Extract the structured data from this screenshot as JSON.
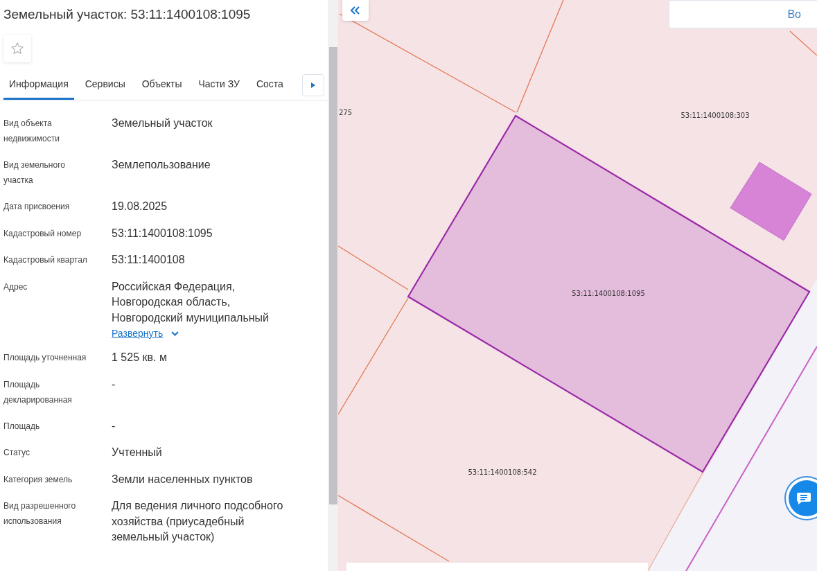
{
  "panel": {
    "title": "Земельный участок: 53:11:1400108:1095",
    "tabs": [
      {
        "label": "Информация",
        "selected": true
      },
      {
        "label": "Сервисы",
        "selected": false
      },
      {
        "label": "Объекты",
        "selected": false
      },
      {
        "label": "Части ЗУ",
        "selected": false
      },
      {
        "label": "Соста",
        "selected": false
      }
    ],
    "fields": [
      {
        "label": "Вид объекта недвижимости",
        "value": "Земельный участок"
      },
      {
        "label": "Вид земельного участка",
        "value": "Землепользование"
      },
      {
        "label": "Дата присвоения",
        "value": "19.08.2025"
      },
      {
        "label": "Кадастровый номер",
        "value": "53:11:1400108:1095"
      },
      {
        "label": "Кадастровый квартал",
        "value": "53:11:1400108"
      },
      {
        "label": "Адрес",
        "value": "Российская Федерация, Новгородская область, Новгородский муниципальный",
        "expand_link": "Развернуть"
      },
      {
        "label": "Площадь уточненная",
        "value": "1 525 кв. м"
      },
      {
        "label": "Площадь декларированная",
        "value": "-"
      },
      {
        "label": "Площадь",
        "value": "-"
      },
      {
        "label": "Статус",
        "value": "Учтенный"
      },
      {
        "label": "Категория земель",
        "value": "Земли населенных пунктов"
      },
      {
        "label": "Вид разрешенного использования",
        "value": "Для ведения личного подсобного хозяйства (приусадебный земельный участок)"
      }
    ]
  },
  "map": {
    "search_text": "Во",
    "parcel_labels": [
      {
        "text": "275"
      },
      {
        "text": "53:11:1400108:303"
      },
      {
        "text": "53:11:1400108:1095"
      },
      {
        "text": "53:11:1400108:542"
      }
    ]
  }
}
